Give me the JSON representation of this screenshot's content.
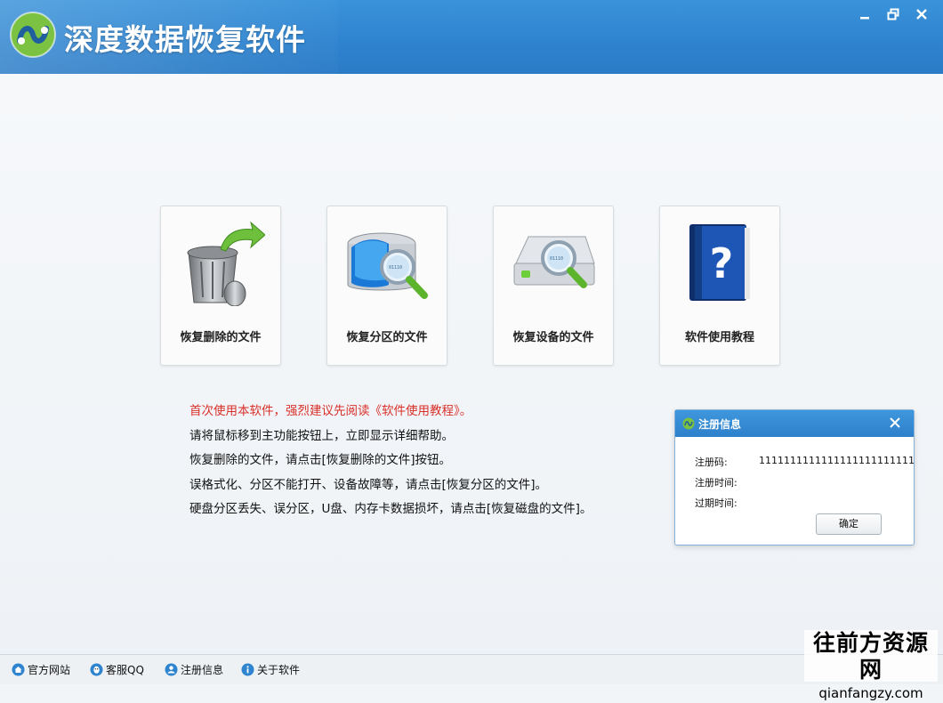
{
  "app": {
    "title": "深度数据恢复软件"
  },
  "window_buttons": [
    "minimize-icon",
    "restore-icon",
    "close-icon"
  ],
  "cards": [
    {
      "label": "恢复删除的文件",
      "icon": "trash-recover-icon"
    },
    {
      "label": "恢复分区的文件",
      "icon": "partition-search-icon"
    },
    {
      "label": "恢复设备的文件",
      "icon": "device-search-icon"
    },
    {
      "label": "软件使用教程",
      "icon": "help-book-icon"
    }
  ],
  "help": {
    "warning": "首次使用本软件，强烈建议先阅读《软件使用教程》。",
    "lines": [
      "请将鼠标移到主功能按钮上，立即显示详细帮助。",
      "恢复删除的文件，请点击[恢复删除的文件]按钮。",
      "误格式化、分区不能打开、设备故障等，请点击[恢复分区的文件]。",
      "硬盘分区丢失、误分区，U盘、内存卡数据损坏，请点击[恢复磁盘的文件]。"
    ]
  },
  "dialog": {
    "title": "注册信息",
    "code_label": "注册码:",
    "code_value": "1111111111111111111111111",
    "reg_time_label": "注册时间:",
    "reg_time_value": "",
    "expire_label": "过期时间:",
    "expire_value": "",
    "ok_label": "确定"
  },
  "statusbar": {
    "items": [
      {
        "label": "官方网站",
        "icon": "home-icon"
      },
      {
        "label": "客服QQ",
        "icon": "qq-icon"
      },
      {
        "label": "注册信息",
        "icon": "user-icon"
      },
      {
        "label": "关于软件",
        "icon": "info-icon"
      }
    ]
  },
  "watermark": {
    "cn": "往前方资源网",
    "en": "qianfangzy.com"
  },
  "colors": {
    "titlebar": "#2f84cf",
    "warning_text": "#d9302a",
    "dialog_header": "#2d80cb"
  }
}
